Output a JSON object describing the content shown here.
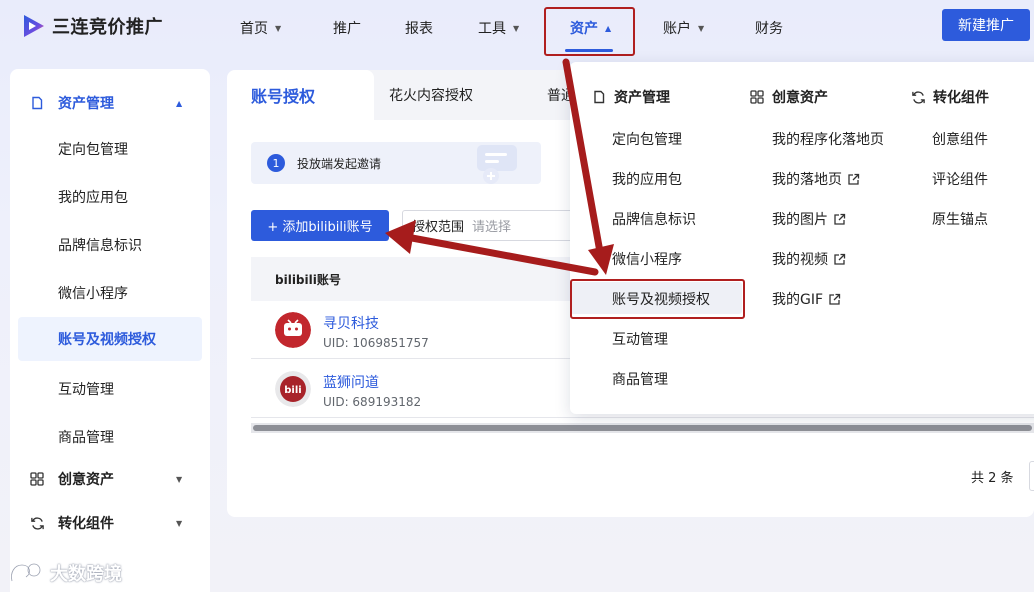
{
  "app": {
    "name": "三连竞价推广"
  },
  "nav": {
    "home": "首页",
    "promote": "推广",
    "report": "报表",
    "tools": "工具",
    "assets": "资产",
    "account": "账户",
    "finance": "财务"
  },
  "new_button": "新建推广",
  "sidebar": {
    "asset_mgmt": "资产管理",
    "items": [
      "定向包管理",
      "我的应用包",
      "品牌信息标识",
      "微信小程序",
      "账号及视频授权",
      "互动管理",
      "商品管理"
    ],
    "creative_assets": "创意资产",
    "conversion": "转化组件"
  },
  "tabs": [
    "账号授权",
    "花火内容授权",
    "普通"
  ],
  "banner": {
    "step": "1",
    "text": "投放端发起邀请"
  },
  "add_button": "+ 添加bilibili账号",
  "scope": {
    "label": "授权范围",
    "placeholder": "请选择"
  },
  "table": {
    "column": "bilibili账号",
    "rows": [
      {
        "name": "寻贝科技",
        "uid": "UID: 1069851757"
      },
      {
        "name": "蓝狮问道",
        "uid": "UID: 689193182"
      }
    ]
  },
  "pagination": {
    "total": "共 2 条"
  },
  "dropdown": {
    "col1_title": "资产管理",
    "col1_items": [
      "定向包管理",
      "我的应用包",
      "品牌信息标识",
      "微信小程序",
      "账号及视频授权",
      "互动管理",
      "商品管理"
    ],
    "col2_title": "创意资产",
    "col2_items": [
      "我的程序化落地页",
      "我的落地页",
      "我的图片",
      "我的视频",
      "我的GIF"
    ],
    "col3_title": "转化组件",
    "col3_items": [
      "创意组件",
      "评论组件",
      "原生锚点"
    ]
  },
  "watermark": "大数跨境",
  "colors": {
    "accent": "#2d5bdc",
    "annotation": "#b01f1f"
  }
}
